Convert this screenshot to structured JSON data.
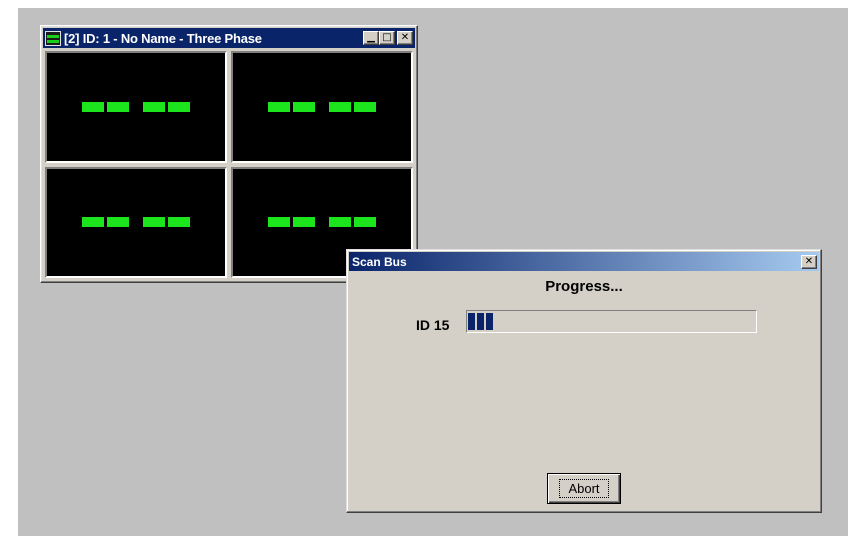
{
  "meter_window": {
    "title": "[2] ID: 1 - No Name - Three Phase",
    "app_icon": "meter-app-icon",
    "minimize_glyph": "▁",
    "maximize_glyph": "□",
    "close_glyph": "✕",
    "panel_count": 4,
    "display_color": "#1de51d"
  },
  "scan_dialog": {
    "title": "Scan Bus",
    "close_glyph": "✕",
    "heading": "Progress...",
    "id_label": "ID 15",
    "progress_fraction": 0.1,
    "abort_label": "Abort"
  },
  "colors": {
    "desktop": "#c0c0c0",
    "title_active": "#0a246a",
    "title_gradient_end": "#a6caf0",
    "face": "#d4d0c8"
  }
}
